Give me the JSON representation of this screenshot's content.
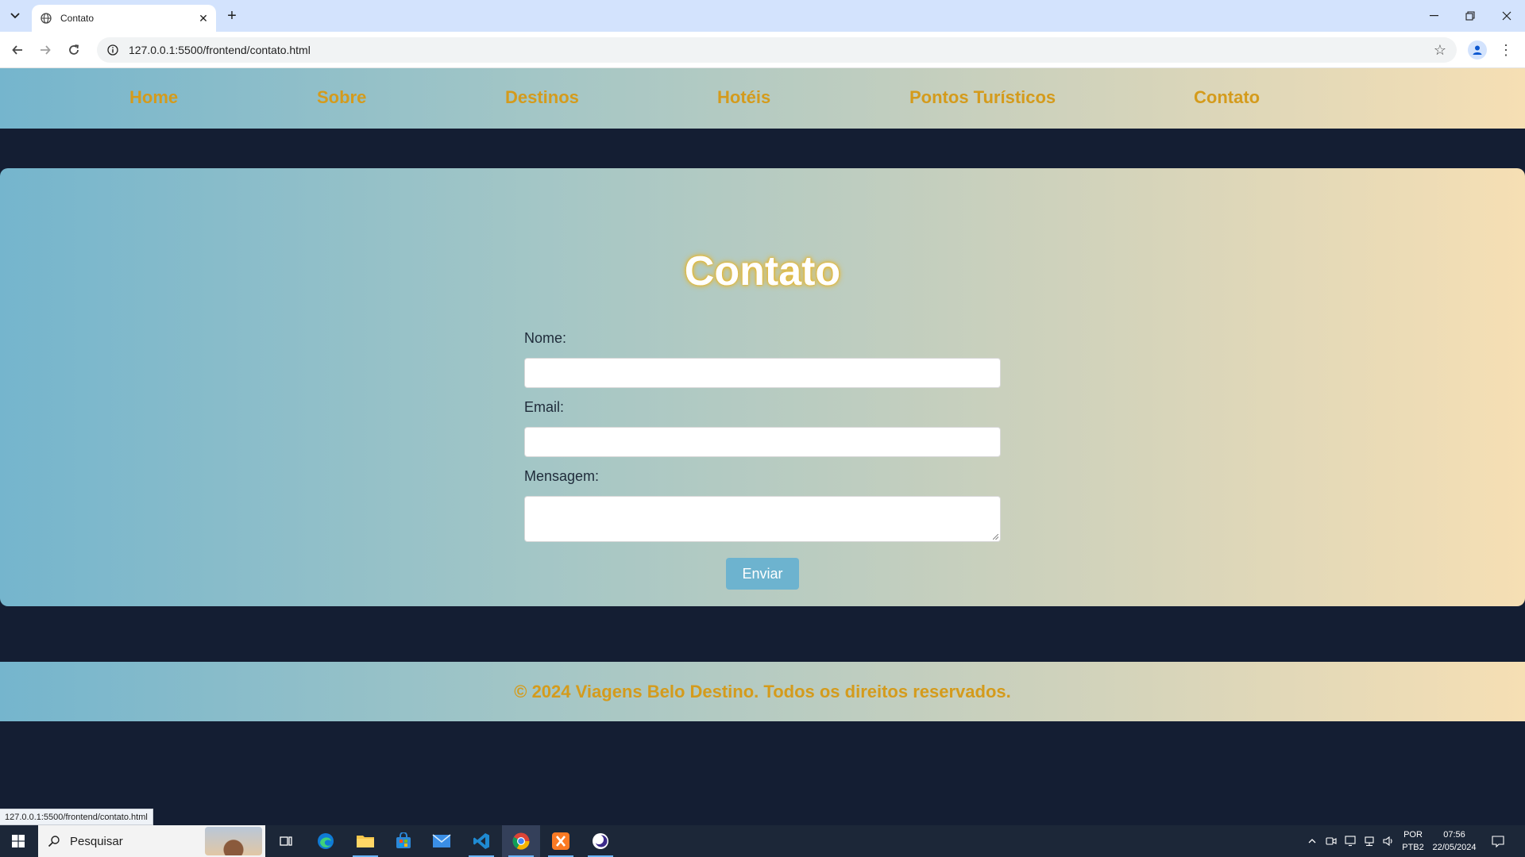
{
  "browser": {
    "tab_title": "Contato",
    "url": "127.0.0.1:5500/frontend/contato.html",
    "status_url": "127.0.0.1:5500/frontend/contato.html"
  },
  "nav": {
    "items": [
      {
        "label": "Home"
      },
      {
        "label": "Sobre"
      },
      {
        "label": "Destinos"
      },
      {
        "label": "Hotéis"
      },
      {
        "label": "Pontos Turísticos"
      },
      {
        "label": "Contato"
      }
    ]
  },
  "contact": {
    "heading": "Contato",
    "name_label": "Nome:",
    "name_value": "",
    "email_label": "Email:",
    "email_value": "",
    "message_label": "Mensagem:",
    "message_value": "",
    "submit_label": "Enviar"
  },
  "footer": {
    "text": "© 2024 Viagens Belo Destino. Todos os direitos reservados."
  },
  "taskbar": {
    "search_placeholder": "Pesquisar",
    "language_line1": "POR",
    "language_line2": "PTB2",
    "time": "07:56",
    "date": "22/05/2024",
    "apps": [
      "task-view-icon",
      "edge-icon",
      "file-explorer-icon",
      "microsoft-store-icon",
      "mail-icon",
      "vscode-icon",
      "chrome-icon",
      "xampp-icon",
      "eclipse-icon"
    ]
  },
  "colors": {
    "page_bg": "#141e33",
    "gradient_start": "#75b5cd",
    "gradient_end": "#f6dfb4",
    "nav_link": "#d49b1c",
    "button": "#6db3cf"
  }
}
